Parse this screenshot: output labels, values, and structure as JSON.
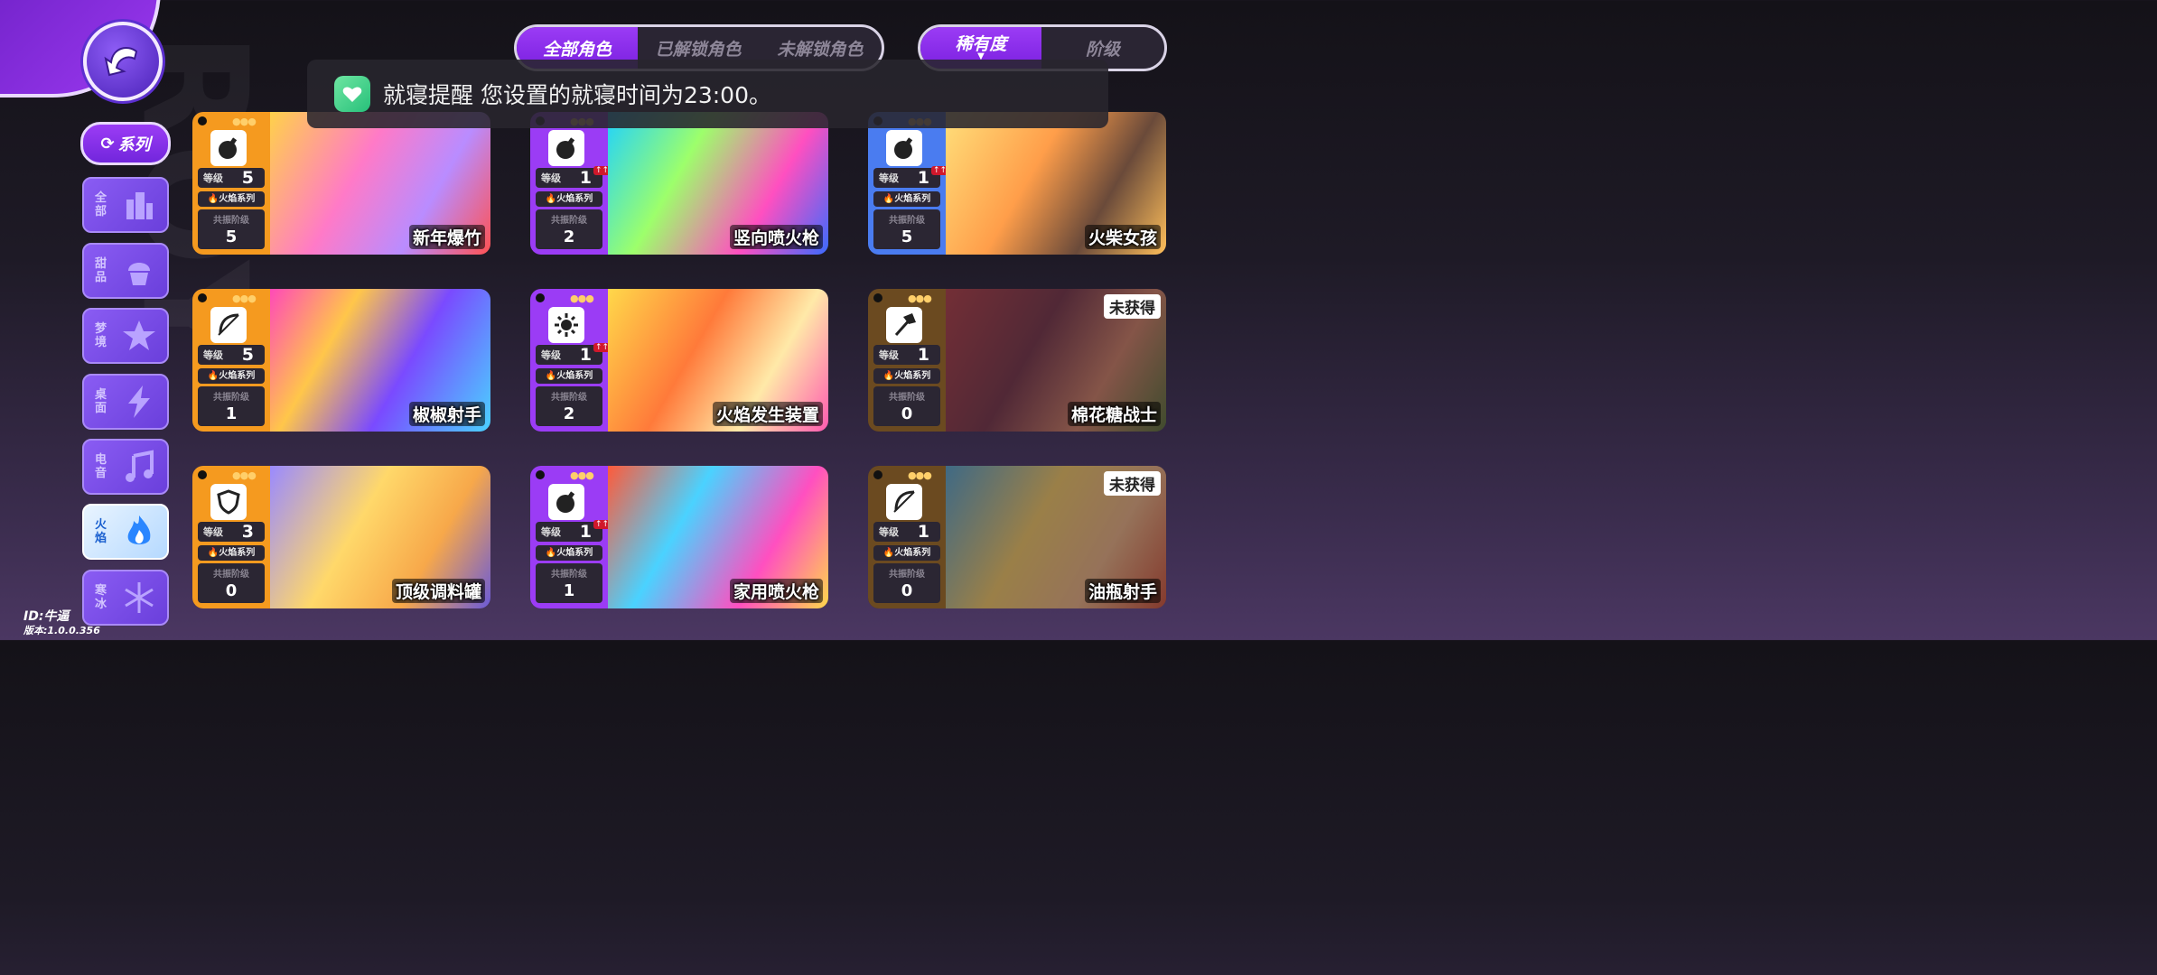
{
  "tabs_roles": {
    "all": "全部角色",
    "unlocked": "已解锁角色",
    "locked": "未解锁角色"
  },
  "tabs_sort": {
    "rarity": "稀有度",
    "tier": "阶级"
  },
  "notification": {
    "text": "就寝提醒 您设置的就寝时间为23:00。"
  },
  "filter_chip": "系列",
  "sidebar": [
    {
      "label": "全部",
      "icon": "city-icon"
    },
    {
      "label": "甜品",
      "icon": "cupcake-icon"
    },
    {
      "label": "梦境",
      "icon": "star-icon"
    },
    {
      "label": "桌面",
      "icon": "lightning-icon"
    },
    {
      "label": "电音",
      "icon": "music-note-icon"
    },
    {
      "label": "火焰",
      "icon": "flame-icon"
    },
    {
      "label": "寒冰",
      "icon": "snowflake-icon"
    }
  ],
  "card_labels": {
    "level": "等级",
    "series": "火焰系列",
    "resonance": "共振阶级",
    "locked": "未获得"
  },
  "cards": [
    {
      "name": "新年爆竹",
      "level": "5",
      "resonance": "5",
      "rarity": "orange",
      "icon": "bomb-icon",
      "upgrade": false,
      "locked": false
    },
    {
      "name": "竖向喷火枪",
      "level": "1",
      "resonance": "2",
      "rarity": "purple",
      "icon": "bomb-icon",
      "upgrade": true,
      "locked": false
    },
    {
      "name": "火柴女孩",
      "level": "1",
      "resonance": "5",
      "rarity": "blue",
      "icon": "bomb-icon",
      "upgrade": true,
      "locked": false
    },
    {
      "name": "椒椒射手",
      "level": "5",
      "resonance": "1",
      "rarity": "orange",
      "icon": "bow-icon",
      "upgrade": false,
      "locked": false
    },
    {
      "name": "火焰发生装置",
      "level": "1",
      "resonance": "2",
      "rarity": "purple",
      "icon": "sun-icon",
      "upgrade": true,
      "locked": false
    },
    {
      "name": "棉花糖战士",
      "level": "1",
      "resonance": "0",
      "rarity": "orange",
      "icon": "axe-icon",
      "upgrade": false,
      "locked": true
    },
    {
      "name": "顶级调料罐",
      "level": "3",
      "resonance": "0",
      "rarity": "orange",
      "icon": "shield-icon",
      "upgrade": false,
      "locked": false
    },
    {
      "name": "家用喷火枪",
      "level": "1",
      "resonance": "1",
      "rarity": "purple",
      "icon": "bomb-icon",
      "upgrade": true,
      "locked": false
    },
    {
      "name": "油瓶射手",
      "level": "1",
      "resonance": "0",
      "rarity": "orange",
      "icon": "bow-icon",
      "upgrade": false,
      "locked": true
    }
  ],
  "footer": {
    "id": "ID:牛逼",
    "version": "版本:1.0.0.356"
  },
  "colors": {
    "orange": "#f59a1f",
    "purple": "#9b3cf5",
    "blue": "#4a7cf0"
  }
}
